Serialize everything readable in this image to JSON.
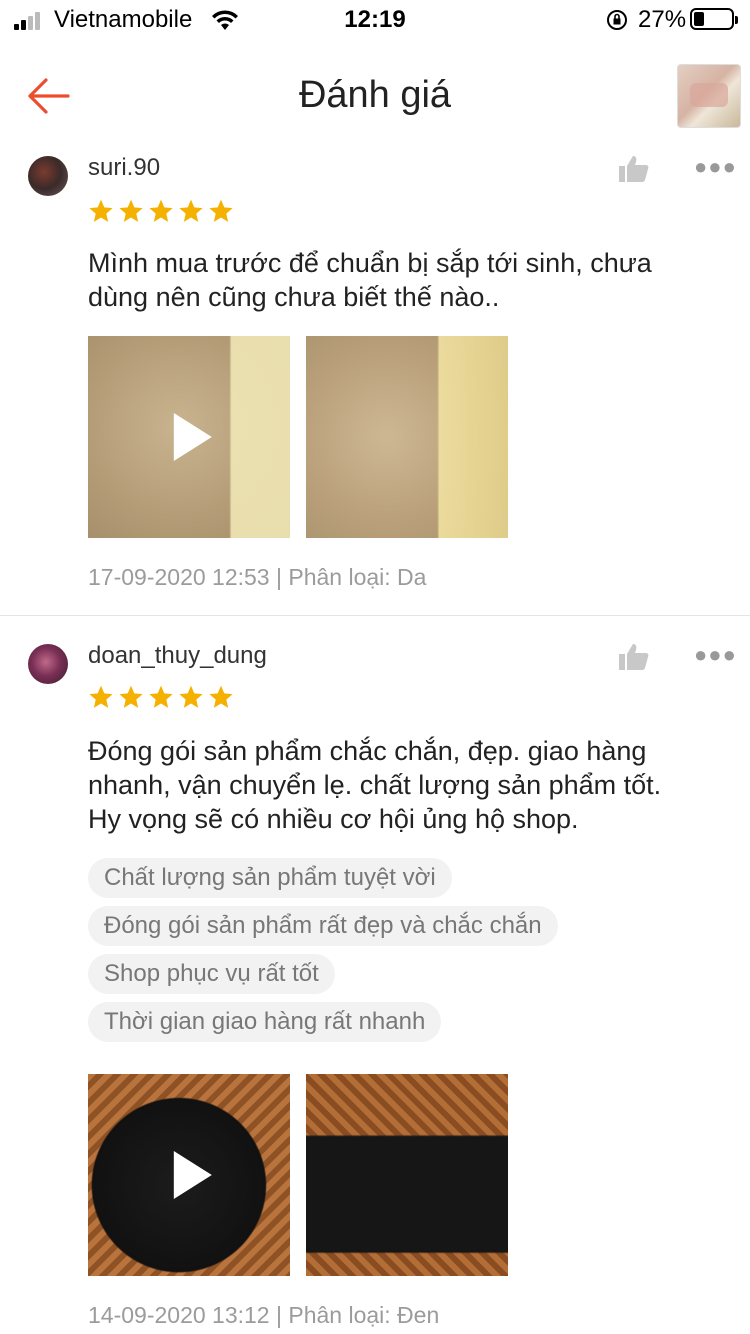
{
  "status_bar": {
    "carrier": "Vietnamobile",
    "time": "12:19",
    "battery": "27%",
    "battery_level": 0.27
  },
  "header": {
    "title": "Đánh giá",
    "back_icon": "back-arrow-icon",
    "accent_color": "#ee4d2d"
  },
  "reviews": [
    {
      "username": "suri.90",
      "rating": 5,
      "text_lines": [
        "Mình mua trước để chuẩn bị sắp tới sinh, chưa",
        "dùng nên cũng chưa biết thế nào.."
      ],
      "tags": [],
      "media": [
        {
          "type": "video"
        },
        {
          "type": "image"
        }
      ],
      "meta": "17-09-2020 12:53 | Phân loại: Da"
    },
    {
      "username": "doan_thuy_dung",
      "rating": 5,
      "text_lines": [
        "Đóng gói sản phẩm chắc chắn, đẹp. giao hàng",
        "nhanh, vận chuyển lẹ. chất lượng sản phẩm tốt.",
        "Hy vọng sẽ có nhiều cơ hội ủng hộ shop."
      ],
      "tags": [
        "Chất lượng sản phẩm tuyệt vời",
        "Đóng gói sản phẩm rất đẹp và chắc chắn",
        "Shop phục vụ rất tốt",
        "Thời gian giao hàng rất nhanh"
      ],
      "media": [
        {
          "type": "video"
        },
        {
          "type": "image"
        }
      ],
      "meta": "14-09-2020 13:12 | Phân loại: Đen"
    }
  ],
  "colors": {
    "star": "#f5b100",
    "tag_bg": "#f2f2f2",
    "meta_text": "#9b9b9b"
  }
}
